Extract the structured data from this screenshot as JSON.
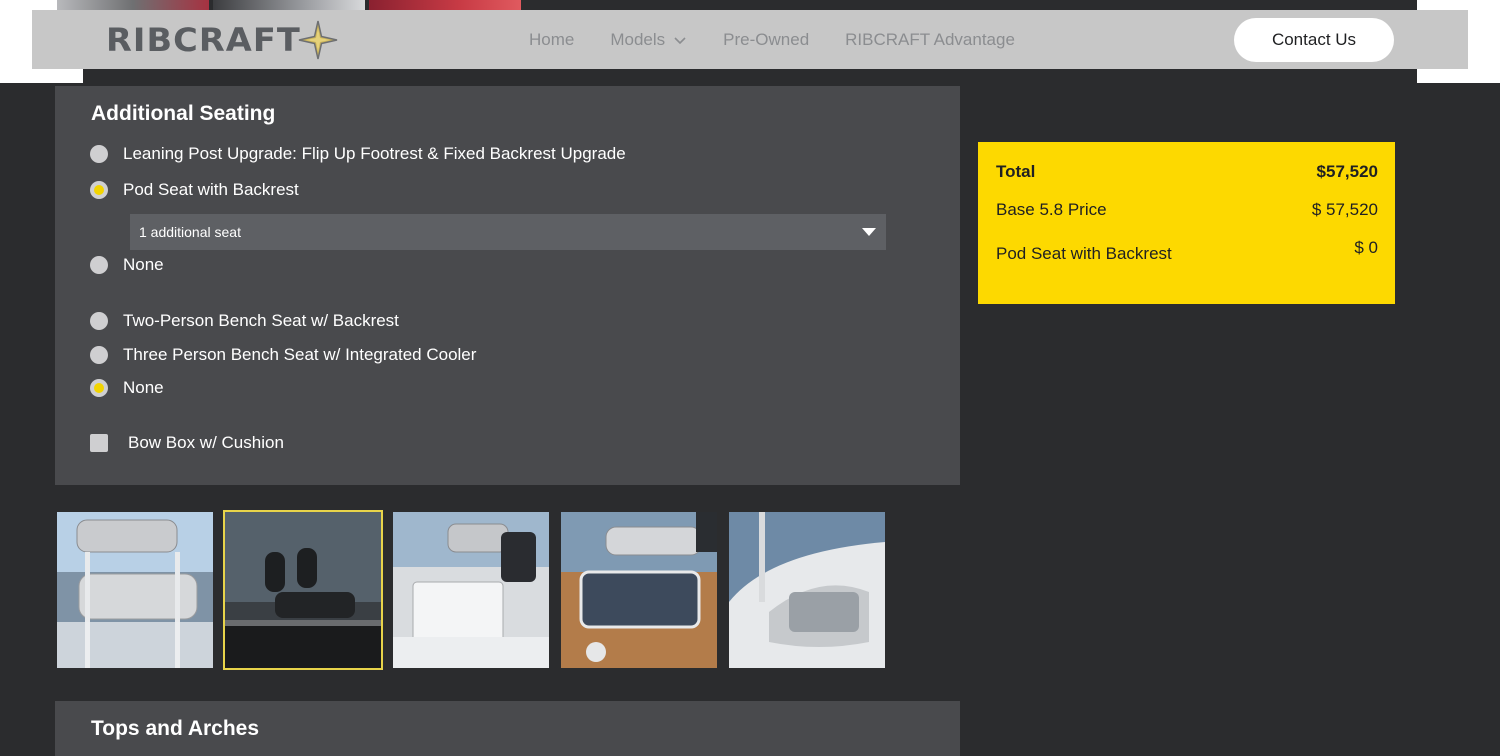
{
  "header": {
    "logo_text": "RIBCRAFT",
    "nav": {
      "home": "Home",
      "models": "Models",
      "preowned": "Pre-Owned",
      "advantage": "RIBCRAFT Advantage"
    },
    "contact_label": "Contact Us"
  },
  "seating": {
    "title": "Additional Seating",
    "group1": [
      {
        "label": "Leaning Post Upgrade: Flip Up Footrest & Fixed Backrest Upgrade",
        "checked": false
      },
      {
        "label": "Pod Seat with Backrest",
        "checked": true
      },
      {
        "label": "None",
        "checked": false
      }
    ],
    "seat_select_value": "1 additional seat",
    "group2": [
      {
        "label": "Two-Person Bench Seat w/ Backrest",
        "checked": false
      },
      {
        "label": "Three Person Bench Seat w/ Integrated Cooler",
        "checked": false
      },
      {
        "label": "None",
        "checked": true
      }
    ],
    "bow_box_label": "Bow Box w/ Cushion",
    "bow_box_checked": false
  },
  "summary": {
    "total_label": "Total",
    "total_value": "$57,520",
    "base_label": "Base 5.8 Price",
    "base_value": "$ 57,520",
    "pod_label": "Pod Seat with Backrest",
    "pod_value": "$ 0"
  },
  "thumbnails": {
    "selected_index": 1,
    "count": 5
  },
  "tops": {
    "title": "Tops and Arches"
  },
  "colors": {
    "page_bg": "#2b2c2e",
    "panel_bg": "#494a4d",
    "accent_yellow": "#fdd900",
    "navbar_bg": "#c7c7c7"
  }
}
